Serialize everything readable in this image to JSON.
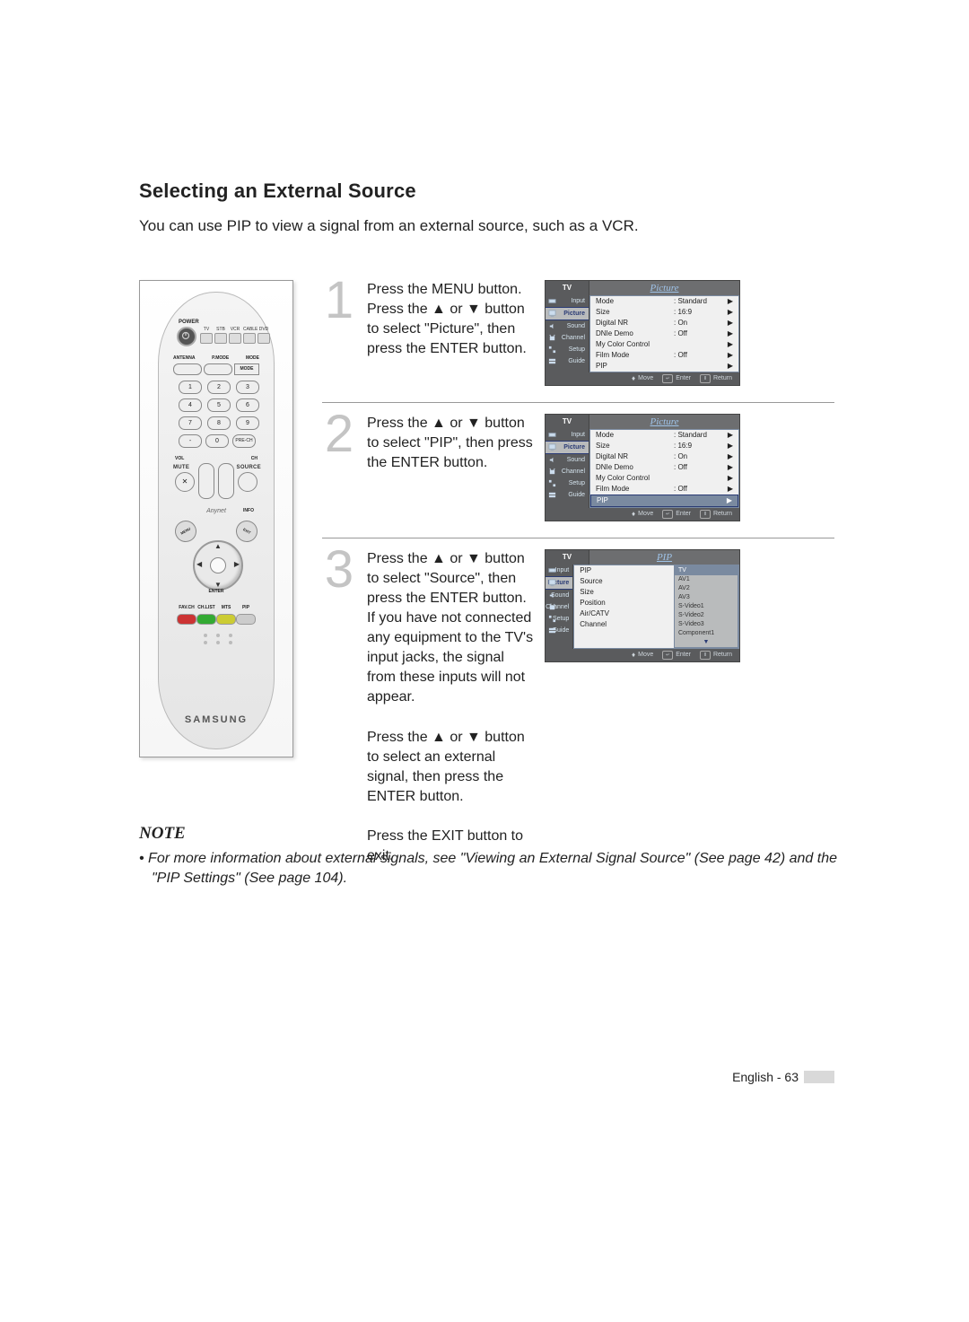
{
  "page": {
    "title": "Selecting an External Source",
    "intro": "You can use PIP to view a signal from an external source, such as a VCR.",
    "footer": "English - 63"
  },
  "remote": {
    "power_label": "POWER",
    "top_labels": [
      "TV",
      "STB",
      "VCR",
      "CABLE",
      "DVD"
    ],
    "mid_labels": {
      "antenna": "ANTENNA",
      "pmode": "P.MODE",
      "mode": "MODE"
    },
    "numbers": [
      "1",
      "2",
      "3",
      "4",
      "5",
      "6",
      "7",
      "8",
      "9",
      "-",
      "0",
      "PRE-CH"
    ],
    "vol": "VOL",
    "ch": "CH",
    "mute": "MUTE",
    "source": "SOURCE",
    "anynet": "Anynet",
    "info": "INFO",
    "menu": "MENU",
    "exit": "EXIT",
    "enter": "ENTER",
    "color_labels": [
      "FAV.CH",
      "CH.LIST",
      "MTS",
      "PIP"
    ],
    "brand": "SAMSUNG"
  },
  "steps": [
    {
      "num": "1",
      "text": "Press the MENU button.\nPress the ▲ or ▼ button to select \"Picture\", then press the ENTER button.",
      "osd": {
        "corner": "TV",
        "title": "Picture",
        "side": [
          "Input",
          "Picture",
          "Sound",
          "Channel",
          "Setup",
          "Guide"
        ],
        "side_selected": "Picture",
        "rows": [
          {
            "label": "Mode",
            "val": ": Standard",
            "car": "▶"
          },
          {
            "label": "Size",
            "val": ": 16:9",
            "car": "▶"
          },
          {
            "label": "Digital NR",
            "val": ": On",
            "car": "▶"
          },
          {
            "label": "DNIe Demo",
            "val": ": Off",
            "car": "▶"
          },
          {
            "label": "My Color Control",
            "val": "",
            "car": "▶"
          },
          {
            "label": "Film Mode",
            "val": ": Off",
            "car": "▶"
          },
          {
            "label": "PIP",
            "val": "",
            "car": "▶"
          }
        ],
        "row_selected": -1,
        "foot": {
          "move": "Move",
          "enter": "Enter",
          "return": "Return"
        }
      }
    },
    {
      "num": "2",
      "text": "Press the ▲ or ▼ button to select \"PIP\", then press the ENTER button.",
      "osd": {
        "corner": "TV",
        "title": "Picture",
        "side": [
          "Input",
          "Picture",
          "Sound",
          "Channel",
          "Setup",
          "Guide"
        ],
        "side_selected": "Picture",
        "rows": [
          {
            "label": "Mode",
            "val": ": Standard",
            "car": "▶"
          },
          {
            "label": "Size",
            "val": ": 16:9",
            "car": "▶"
          },
          {
            "label": "Digital NR",
            "val": ": On",
            "car": "▶"
          },
          {
            "label": "DNIe Demo",
            "val": ": Off",
            "car": "▶"
          },
          {
            "label": "My Color Control",
            "val": "",
            "car": "▶"
          },
          {
            "label": "Film Mode",
            "val": ": Off",
            "car": "▶"
          },
          {
            "label": "PIP",
            "val": "",
            "car": "▶"
          }
        ],
        "row_selected": 6,
        "foot": {
          "move": "Move",
          "enter": "Enter",
          "return": "Return"
        }
      }
    },
    {
      "num": "3",
      "text": "Press the ▲ or ▼ button to select \"Source\", then press the ENTER button.\nIf you have not connected any equipment to the TV's input jacks, the signal from these inputs will not appear.\n\nPress the ▲ or ▼ button to select an external signal, then press the ENTER button.\n\nPress the EXIT button to exit.",
      "osd": {
        "corner": "TV",
        "title": "PIP",
        "side": [
          "Input",
          "Picture",
          "Sound",
          "Channel",
          "Setup",
          "Guide"
        ],
        "side_selected": "Picture",
        "rows": [
          {
            "label": "PIP",
            "val": "",
            "car": ""
          },
          {
            "label": "Source",
            "val": "",
            "car": ""
          },
          {
            "label": "Size",
            "val": "",
            "car": ""
          },
          {
            "label": "Position",
            "val": "",
            "car": ""
          },
          {
            "label": "Air/CATV",
            "val": "",
            "car": ""
          },
          {
            "label": "Channel",
            "val": "",
            "car": ""
          }
        ],
        "row_selected": -1,
        "sourcelist": [
          "TV",
          "AV1",
          "AV2",
          "AV3",
          "S-Video1",
          "S-Video2",
          "S-Video3",
          "Component1"
        ],
        "sourcelist_selected": 0,
        "foot": {
          "move": "Move",
          "enter": "Enter",
          "return": "Return"
        }
      }
    }
  ],
  "note": {
    "heading": "NOTE",
    "body": "• For more information about external signals, see \"Viewing an External Signal Source\" (See page 42) and the \"PIP Settings\" (See page 104)."
  }
}
